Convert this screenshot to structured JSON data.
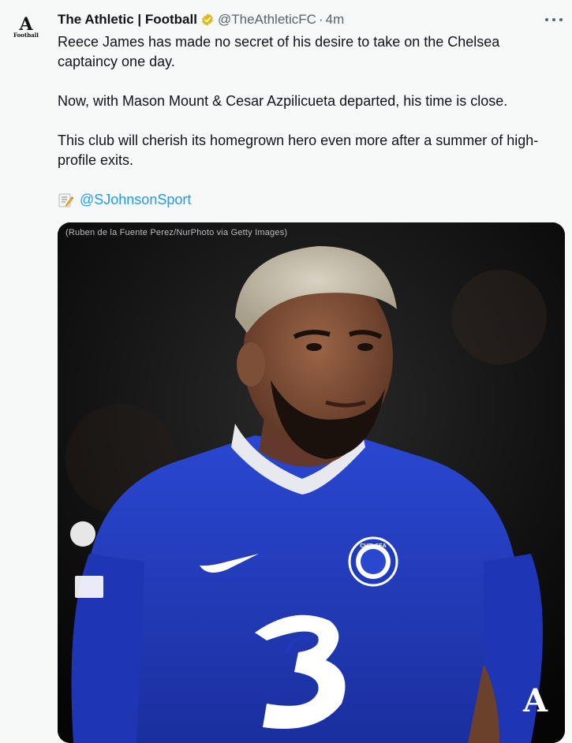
{
  "tweet": {
    "display_name": "The Athletic | Football",
    "handle": "@TheAthleticFC",
    "separator": "·",
    "time": "4m",
    "avatar_text": "A",
    "avatar_subtext": "Football",
    "verified_color": "#e2b719",
    "paragraphs": [
      "Reece James has made no secret of his desire to take on the Chelsea captaincy one day.",
      "Now, with Mason Mount & Cesar Azpilicueta departed, his time is close.",
      "This club will cherish its homegrown hero even more after a summer of high-profile exits."
    ],
    "memo_icon": "memo-icon",
    "mention": "@SJohnsonSport",
    "media": {
      "credit": "(Ruben de la Fuente Perez/NurPhoto via Getty Images)",
      "watermark": "A",
      "crest_text": "CHELSEA"
    }
  },
  "colors": {
    "link": "#1d9bf0",
    "secondary_text": "#536471",
    "background": "#f7f9f9",
    "kit_blue": "#1f3bbd"
  }
}
